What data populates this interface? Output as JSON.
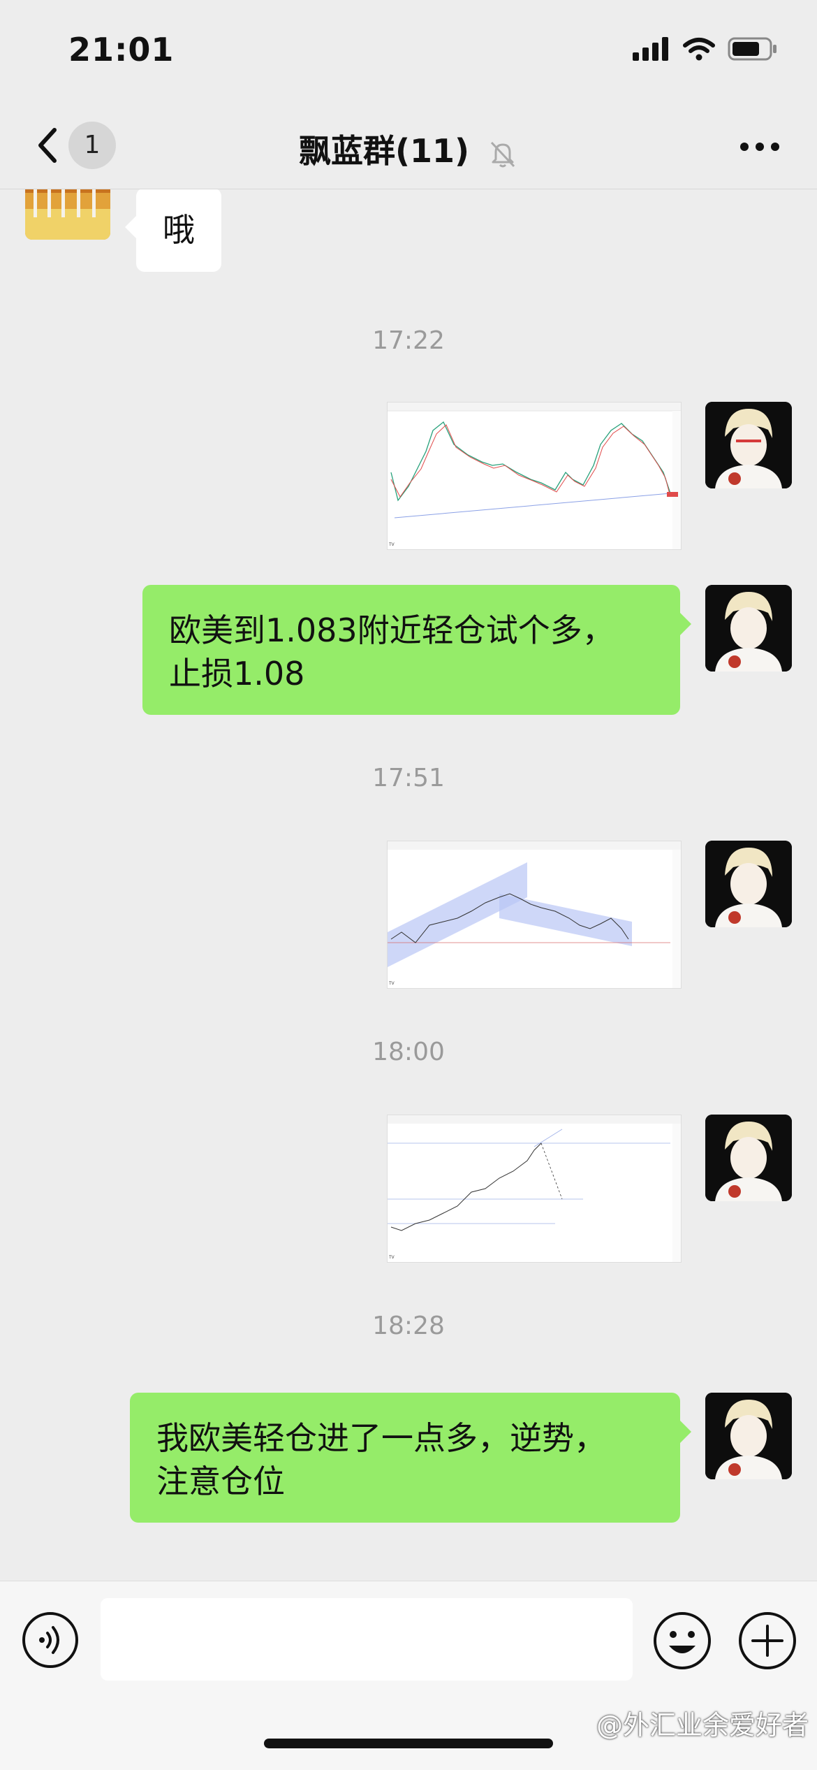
{
  "status_bar": {
    "time": "21:01"
  },
  "header": {
    "back_count": "1",
    "title": "飘蓝群(11)"
  },
  "messages": {
    "m1": {
      "sender": "left",
      "text": "哦"
    },
    "t1": "17:22",
    "t2": "17:51",
    "t3": "18:00",
    "t4": "18:28",
    "m3": {
      "sender": "right",
      "text_line1": "欧美到1.083附近轻仓试个多，",
      "text_line2": "止损1.08"
    },
    "m6": {
      "sender": "right",
      "text_line1": "我欧美轻仓进了一点多，逆势，",
      "text_line2": "注意仓位"
    }
  },
  "input_bar": {
    "placeholder": ""
  },
  "watermark": "@外汇业余爱好者",
  "colors": {
    "green_bubble": "#95ec69",
    "background": "#ededed"
  }
}
